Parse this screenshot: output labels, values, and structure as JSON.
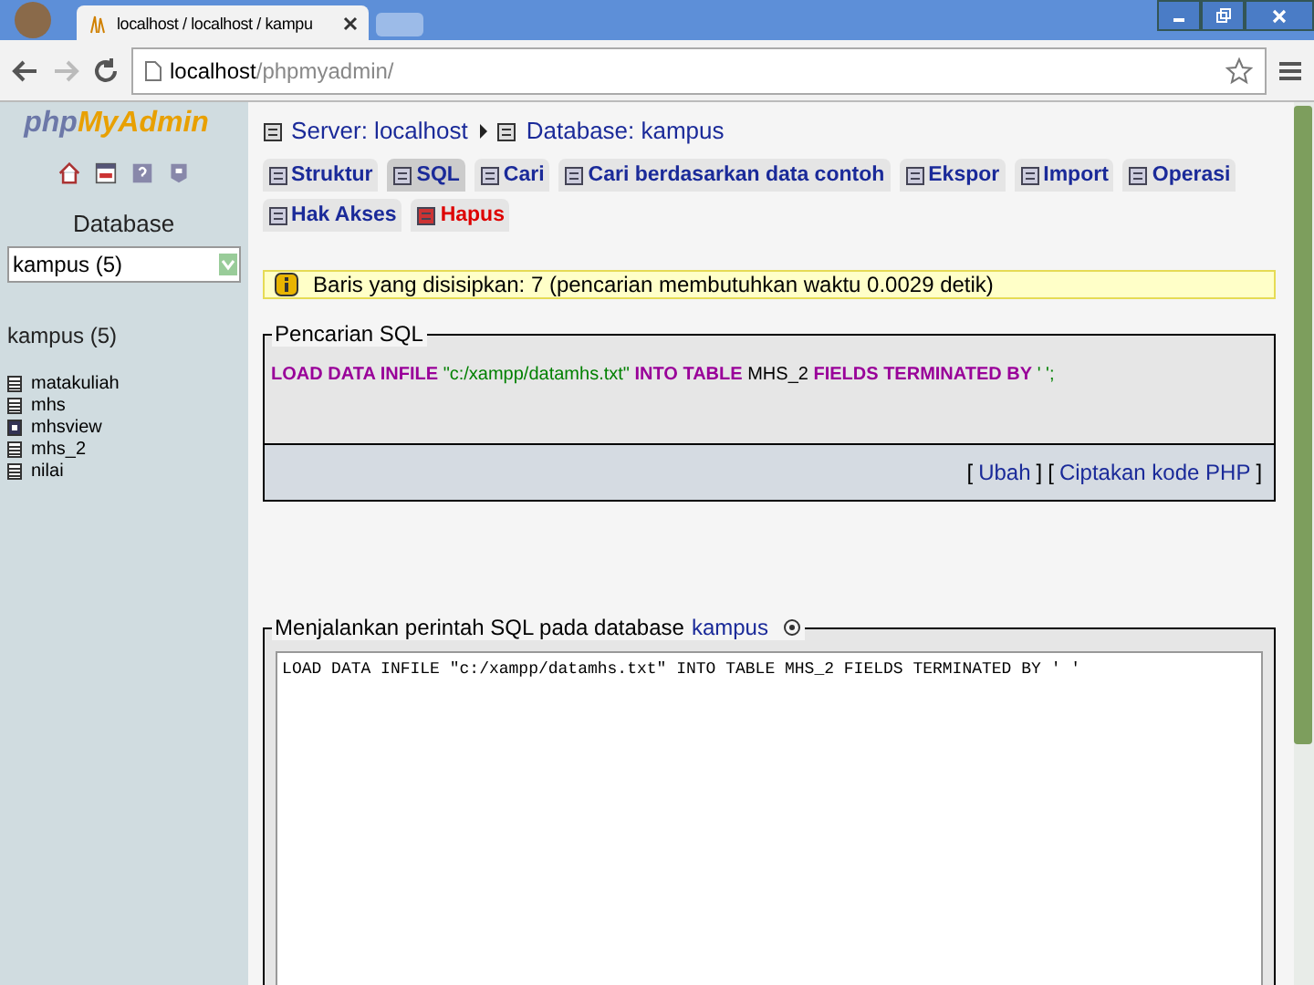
{
  "browser": {
    "tab_title": "localhost / localhost / kampu",
    "url_host": "localhost",
    "url_path": "/phpmyadmin/"
  },
  "sidebar": {
    "logo_php": "php",
    "logo_rest": "MyAdmin",
    "database_label": "Database",
    "database_select": "kampus (5)",
    "db_heading": "kampus (5)",
    "tables": [
      {
        "name": "matakuliah",
        "kind": "table"
      },
      {
        "name": "mhs",
        "kind": "table"
      },
      {
        "name": "mhsview",
        "kind": "view"
      },
      {
        "name": "mhs_2",
        "kind": "table"
      },
      {
        "name": "nilai",
        "kind": "table"
      }
    ]
  },
  "breadcrumb": [
    {
      "label": "Server: localhost"
    },
    {
      "label": "Database: kampus"
    }
  ],
  "tabs": [
    {
      "label": "Struktur",
      "selected": false,
      "kind": "normal"
    },
    {
      "label": "SQL",
      "selected": true,
      "kind": "normal"
    },
    {
      "label": "Cari",
      "selected": false,
      "kind": "normal"
    },
    {
      "label": "Cari berdasarkan data contoh",
      "selected": false,
      "kind": "normal"
    },
    {
      "label": "Ekspor",
      "selected": false,
      "kind": "normal"
    },
    {
      "label": "Import",
      "selected": false,
      "kind": "normal"
    },
    {
      "label": "Operasi",
      "selected": false,
      "kind": "normal"
    },
    {
      "label": "Hak Akses",
      "selected": false,
      "kind": "normal"
    },
    {
      "label": "Hapus",
      "selected": false,
      "kind": "danger"
    }
  ],
  "notice": "Baris yang disisipkan: 7 (pencarian membutuhkan waktu 0.0029 detik)",
  "query_box": {
    "legend": "Pencarian SQL",
    "tokens": [
      {
        "text": "LOAD DATA INFILE",
        "kind": "keyword"
      },
      {
        "text": "\"c:/xampp/datamhs.txt\"",
        "kind": "string"
      },
      {
        "text": "INTO TABLE",
        "kind": "keyword"
      },
      {
        "text": "MHS_2",
        "kind": "name"
      },
      {
        "text": "FIELDS TERMINATED BY",
        "kind": "keyword"
      },
      {
        "text": "' ';",
        "kind": "string"
      }
    ],
    "links": [
      {
        "open": "[",
        "label": "Ubah",
        "close": "]"
      },
      {
        "open": "[",
        "label": "Ciptakan kode PHP",
        "close": "]"
      }
    ]
  },
  "run_box": {
    "legend": "Menjalankan perintah SQL pada database",
    "db_link": "kampus",
    "query": "LOAD DATA INFILE \"c:/xampp/datamhs.txt\" INTO TABLE MHS_2 FIELDS TERMINATED BY ' '"
  }
}
